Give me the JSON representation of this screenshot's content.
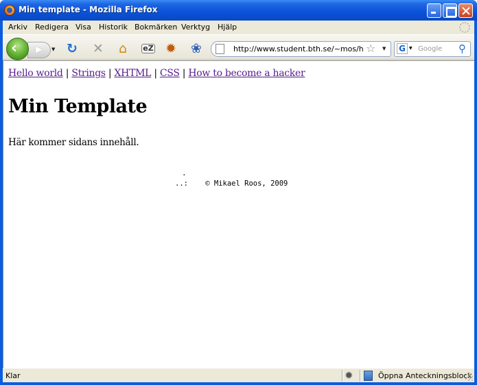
{
  "window": {
    "title": "Min template - Mozilla Firefox"
  },
  "menubar": {
    "items": [
      "Arkiv",
      "Redigera",
      "Visa",
      "Historik",
      "Bokmärken",
      "Verktyg",
      "Hjälp"
    ]
  },
  "navbar": {
    "url": "http://www.student.bth.se/~mos/hello",
    "search_placeholder": "Google",
    "search_engine_letter": "G",
    "icons": [
      "back-icon",
      "forward-icon",
      "history-dropdown-icon",
      "reload-icon",
      "stop-icon",
      "home-icon",
      "extension-icon",
      "firebug-icon",
      "extension-icon",
      "bookmark-star-icon",
      "search-go-icon"
    ]
  },
  "page": {
    "links": [
      "Hello world",
      "Strings",
      "XHTML",
      "CSS",
      "How to become a hacker"
    ],
    "separator": "|",
    "heading": "Min Template",
    "content": "Här kommer sidans innehåll.",
    "footer_dot": ".",
    "footer": "..:    © Mikael Roos, 2009"
  },
  "statusbar": {
    "status": "Klar",
    "notes_label": "Öppna Anteckningsblock"
  },
  "colors": {
    "titlebar": "#0a52d8",
    "chrome": "#ece9d8",
    "visited_link": "#551a8b"
  }
}
